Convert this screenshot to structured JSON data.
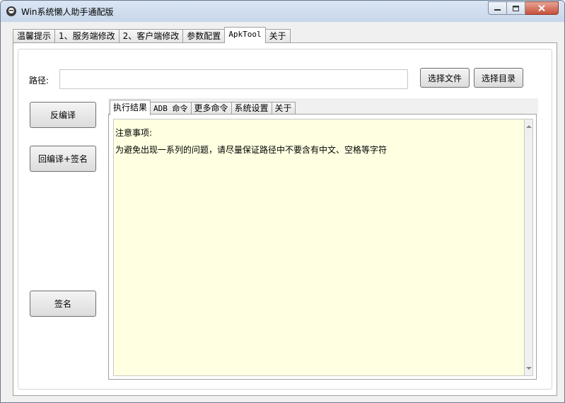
{
  "window": {
    "title": "Win系统懒人助手通配版",
    "min_icon": "minimize-icon",
    "max_icon": "maximize-icon",
    "close_icon": "close-icon"
  },
  "main_tabs": [
    {
      "label": "温馨提示"
    },
    {
      "label": "1、服务端修改"
    },
    {
      "label": "2、客户端修改"
    },
    {
      "label": "参数配置"
    },
    {
      "label": "ApkTool",
      "active": true
    },
    {
      "label": "关于"
    }
  ],
  "path": {
    "label": "路径:",
    "value": "",
    "placeholder": ""
  },
  "buttons": {
    "select_file": "选择文件",
    "select_dir": "选择目录",
    "decompile": "反编译",
    "recompile_sign": "回编译+签名",
    "sign": "签名"
  },
  "sub_tabs": [
    {
      "label": "执行结果",
      "active": true
    },
    {
      "label": "ADB 命令"
    },
    {
      "label": "更多命令"
    },
    {
      "label": "系统设置"
    },
    {
      "label": "关于"
    }
  ],
  "output": {
    "lines": [
      "注意事项:",
      "为避免出现一系列的问题，请尽量保证路径中不要含有中文、空格等字符"
    ]
  },
  "colors": {
    "output_bg": "#ffffe1",
    "close_button": "#c7503b"
  }
}
